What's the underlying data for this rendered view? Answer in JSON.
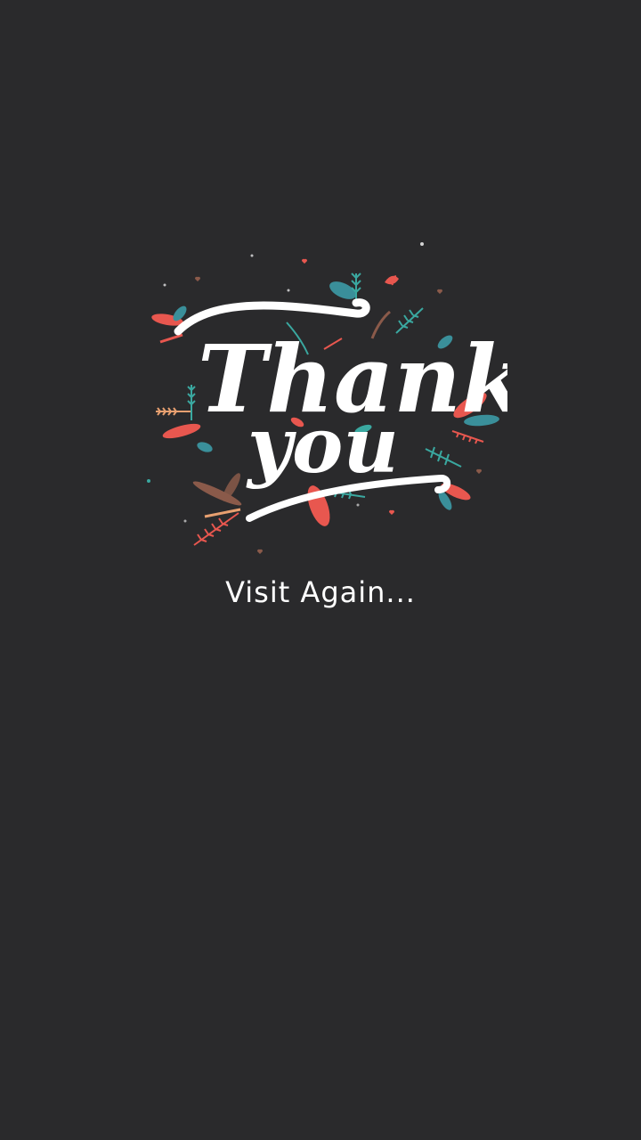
{
  "illustration": {
    "line1": "Thank",
    "line2": "you"
  },
  "tagline": "Visit Again...",
  "colors": {
    "background": "#2a2a2c",
    "text": "#ffffff",
    "coral": "#e8574f",
    "teal": "#3aa8a0",
    "brown": "#8a5a4a"
  }
}
